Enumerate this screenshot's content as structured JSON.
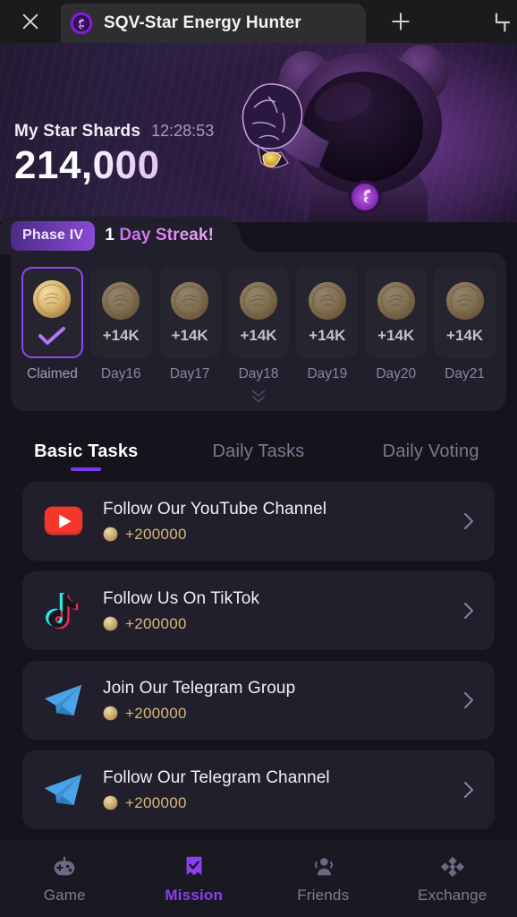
{
  "browser": {
    "close_icon": "close-icon",
    "tab_title": "SQV-Star Energy Hunter",
    "favicon": "sqv-logo-icon",
    "new_tab_icon": "plus-icon",
    "corner_icon": "crop-corner-icon"
  },
  "hero": {
    "shards_label": "My Star Shards",
    "timer": "12:28:53",
    "shards_value": "214,000",
    "illustration": "bear-astronaut-illustration"
  },
  "streak": {
    "phase_label": "Phase IV",
    "streak_count": "1",
    "streak_text": " Day Streak!",
    "expand_icon": "double-chevron-down-icon",
    "days": [
      {
        "label": "Claimed",
        "amount": "",
        "state": "claimed",
        "icon": "check-icon"
      },
      {
        "label": "Day16",
        "amount": "+14K",
        "state": "locked",
        "icon": "coin-icon"
      },
      {
        "label": "Day17",
        "amount": "+14K",
        "state": "locked",
        "icon": "coin-icon"
      },
      {
        "label": "Day18",
        "amount": "+14K",
        "state": "locked",
        "icon": "coin-icon"
      },
      {
        "label": "Day19",
        "amount": "+14K",
        "state": "locked",
        "icon": "coin-icon"
      },
      {
        "label": "Day20",
        "amount": "+14K",
        "state": "locked",
        "icon": "coin-icon"
      },
      {
        "label": "Day21",
        "amount": "+14K",
        "state": "locked",
        "icon": "coin-icon"
      }
    ]
  },
  "tabs": [
    {
      "label": "Basic Tasks",
      "active": true
    },
    {
      "label": "Daily Tasks",
      "active": false
    },
    {
      "label": "Daily Voting",
      "active": false
    }
  ],
  "tasks": [
    {
      "title": "Follow Our YouTube Channel",
      "reward": "+200000",
      "icon": "youtube-icon",
      "arrow": "chevron-right-icon"
    },
    {
      "title": "Follow Us On TikTok",
      "reward": "+200000",
      "icon": "tiktok-icon",
      "arrow": "chevron-right-icon"
    },
    {
      "title": "Join Our Telegram Group",
      "reward": "+200000",
      "icon": "telegram-icon",
      "arrow": "chevron-right-icon"
    },
    {
      "title": "Follow Our Telegram Channel",
      "reward": "+200000",
      "icon": "telegram-icon",
      "arrow": "chevron-right-icon"
    }
  ],
  "bottom_nav": [
    {
      "label": "Game",
      "icon": "gamepad-icon",
      "active": false
    },
    {
      "label": "Mission",
      "icon": "mission-check-icon",
      "active": true
    },
    {
      "label": "Friends",
      "icon": "friends-icon",
      "active": false
    },
    {
      "label": "Exchange",
      "icon": "exchange-diamond-icon",
      "active": false
    }
  ],
  "colors": {
    "accent_purple": "#7c3aed",
    "active_purple": "#8b3ff0",
    "gold": "#d8b978",
    "card_bg": "#211f2c",
    "page_bg": "#15141c"
  }
}
